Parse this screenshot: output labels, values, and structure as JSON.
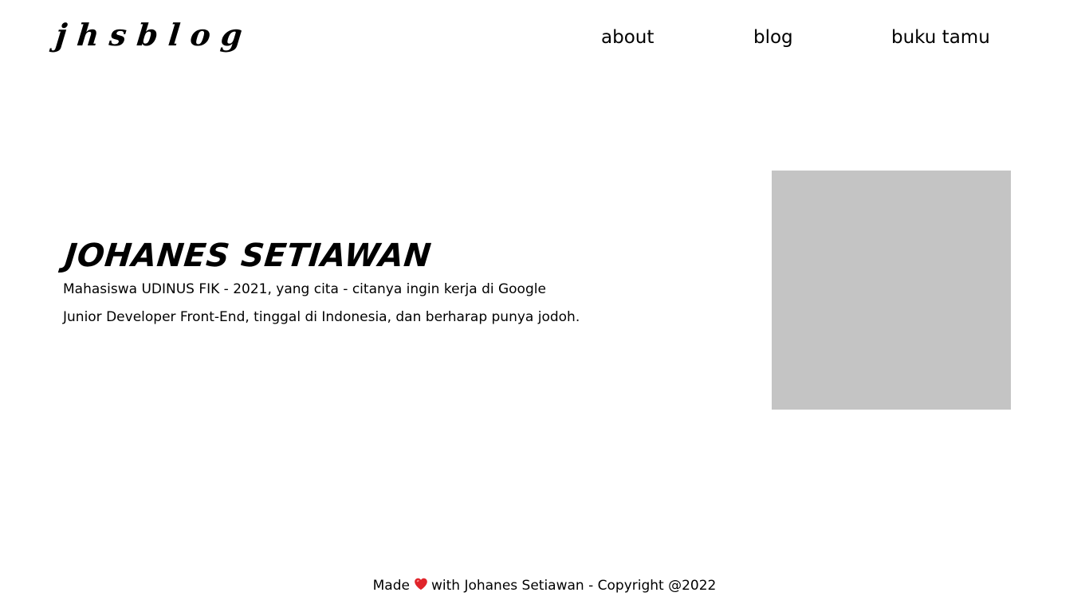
{
  "header": {
    "logo": "jhsblog",
    "nav": [
      {
        "label": "about"
      },
      {
        "label": "blog"
      },
      {
        "label": "buku tamu"
      }
    ]
  },
  "hero": {
    "name": "JOHANES SETIAWAN",
    "line1": "Mahasiswa UDINUS FIK - 2021, yang cita - citanya ingin kerja di Google",
    "line2": "Junior Developer Front-End, tinggal di Indonesia, dan berharap punya jodoh."
  },
  "photo": {
    "placeholder_color": "#c4c4c4"
  },
  "footer": {
    "prefix": "Made",
    "icon": "heart-icon",
    "suffix": "with Johanes Setiawan - Copyright @2022"
  },
  "colors": {
    "text": "#000000",
    "background": "#ffffff",
    "heart": "#e0242a"
  }
}
